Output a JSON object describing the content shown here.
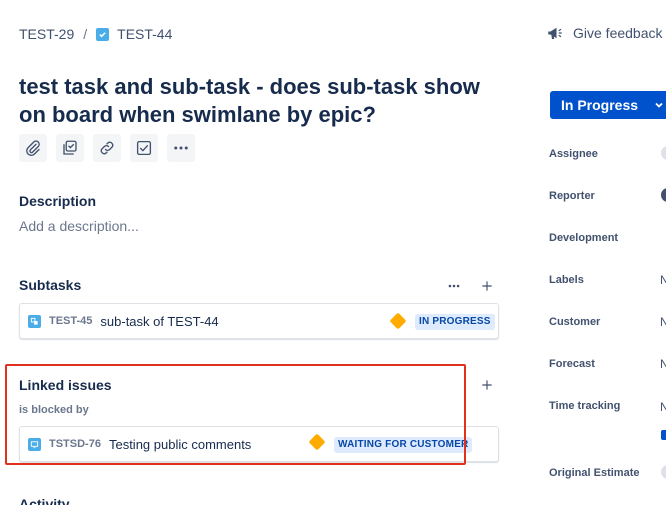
{
  "breadcrumb": {
    "parent": "TEST-29",
    "separator": "/",
    "current": "TEST-44"
  },
  "header": {
    "feedback_label": "Give feedback"
  },
  "issue": {
    "title": "test task and sub-task - does sub-task show on board when swimlane by epic?"
  },
  "description": {
    "heading": "Description",
    "placeholder": "Add a description..."
  },
  "subtasks": {
    "heading": "Subtasks",
    "items": [
      {
        "key": "TEST-45",
        "summary": "sub-task of TEST-44",
        "status": "IN PROGRESS",
        "priority": "medium"
      }
    ]
  },
  "linked_issues": {
    "heading": "Linked issues",
    "relation": "is blocked by",
    "items": [
      {
        "key": "TSTSD-76",
        "summary": "Testing public comments",
        "status": "WAITING FOR CUSTOMER",
        "priority": "medium"
      }
    ]
  },
  "activity": {
    "heading": "Activity"
  },
  "sidebar": {
    "status": "In Progress",
    "fields": {
      "assignee": "Assignee",
      "reporter": "Reporter",
      "development": "Development",
      "labels": "Labels",
      "labels_value": "N",
      "customer": "Customer",
      "customer_value": "N",
      "forecast": "Forecast",
      "forecast_value": "N",
      "time_tracking": "Time tracking",
      "time_tracking_value": "N",
      "original_estimate": "Original Estimate"
    }
  },
  "colors": {
    "accent": "#0052cc",
    "highlight_box": "#e0301e",
    "priority_medium": "#ffab00",
    "lozenge_bg": "#deebff",
    "lozenge_text": "#0747a6"
  },
  "icons": {
    "attach": "paperclip-icon",
    "subtask": "subtask-icon",
    "link": "link-icon",
    "checklist": "checkbox-icon",
    "more": "more-icon",
    "feedback": "megaphone-icon",
    "add": "plus-icon"
  }
}
